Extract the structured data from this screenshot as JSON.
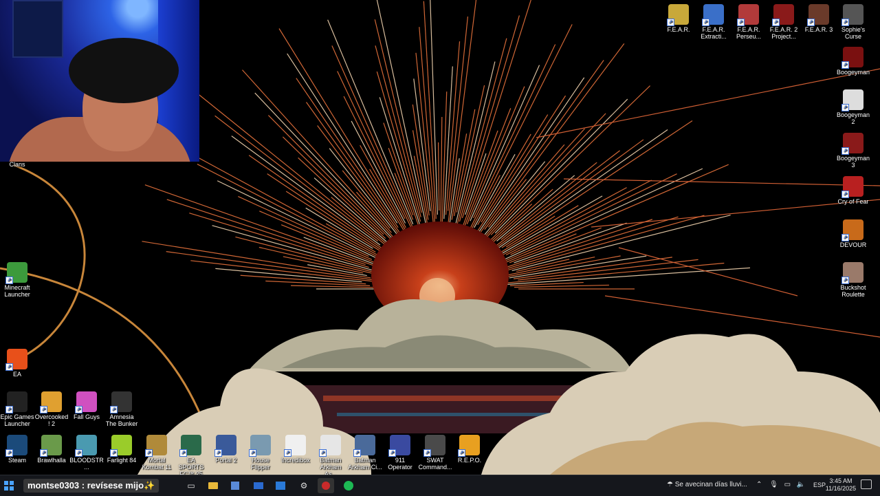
{
  "colors": {
    "taskbar": "#15171c",
    "sun_red": "#9a1a10",
    "ray_orange": "#e8733c",
    "cloud": "#d9cdb6"
  },
  "webcam": {
    "caption": "Clans"
  },
  "desktop_icons": [
    {
      "name": "fear",
      "label": "F.E.A.R.",
      "color": "#c8a83a"
    },
    {
      "name": "fear-extraction",
      "label": "F.E.A.R. Extracti...",
      "color": "#3a6fc8"
    },
    {
      "name": "fear-perseus",
      "label": "F.E.A.R. Perseu...",
      "color": "#b23a3a"
    },
    {
      "name": "fear-2",
      "label": "F.E.A.R. 2 Project...",
      "color": "#8a1a1a"
    },
    {
      "name": "fear-3",
      "label": "F.E.A.R. 3",
      "color": "#6a3a2a"
    },
    {
      "name": "sophies-curse",
      "label": "Sophie's Curse",
      "color": "#555555"
    },
    {
      "name": "boogeyman",
      "label": "Boogeyman",
      "color": "#7a1010"
    },
    {
      "name": "boogeyman-2",
      "label": "Boogeyman 2",
      "color": "#dddddd"
    },
    {
      "name": "boogeyman-3",
      "label": "Boogeyman 3",
      "color": "#8a1a1a"
    },
    {
      "name": "cry-of-fear",
      "label": "Cry of Fear",
      "color": "#b82020"
    },
    {
      "name": "devour",
      "label": "DEVOUR",
      "color": "#c86a1a"
    },
    {
      "name": "buckshot-roulette",
      "label": "Buckshot Roulette",
      "color": "#9a7a6a"
    },
    {
      "name": "minecraft-launcher",
      "label": "Minecraft Launcher",
      "color": "#3c9a3c"
    },
    {
      "name": "ea",
      "label": "EA",
      "color": "#e8501a"
    },
    {
      "name": "epic-games",
      "label": "Epic Games Launcher",
      "color": "#222222"
    },
    {
      "name": "overcooked-2",
      "label": "Overcooked! 2",
      "color": "#e0a030"
    },
    {
      "name": "fall-guys",
      "label": "Fall Guys",
      "color": "#d050c0"
    },
    {
      "name": "amnesia-bunker",
      "label": "Amnesia The Bunker",
      "color": "#333333"
    },
    {
      "name": "steam",
      "label": "Steam",
      "color": "#1b4a7a"
    },
    {
      "name": "brawlhalla",
      "label": "Brawlhalla",
      "color": "#6a9a4a"
    },
    {
      "name": "bloodstrike",
      "label": "BLOODSTR...",
      "color": "#4a9ab0"
    },
    {
      "name": "farlight-84",
      "label": "Farlight 84",
      "color": "#9acc2a"
    },
    {
      "name": "mortal-kombat-11",
      "label": "Mortal Kombat 11",
      "color": "#b08a3a"
    },
    {
      "name": "ea-sports-fc",
      "label": "EA SPORTS FC™ 25",
      "color": "#2a6a4a"
    },
    {
      "name": "portal-2",
      "label": "Portal 2",
      "color": "#3a5a9a"
    },
    {
      "name": "house-flipper",
      "label": "House Flipper",
      "color": "#7a9ab0"
    },
    {
      "name": "incredibox",
      "label": "Incredibox",
      "color": "#f0f0f0"
    },
    {
      "name": "batman-asylum",
      "label": "Batman Arkham As...",
      "color": "#e6e6e6"
    },
    {
      "name": "batman-city",
      "label": "Batman Arkham Ci...",
      "color": "#4a6a9a"
    },
    {
      "name": "911-operator",
      "label": "911 Operator",
      "color": "#3a4aa0"
    },
    {
      "name": "swat-commander",
      "label": "SWAT Command...",
      "color": "#4a4a4a"
    },
    {
      "name": "repo",
      "label": "R.E.P.O.",
      "color": "#e8a020"
    }
  ],
  "taskbar": {
    "chat_overlay": "montse0303 : revísese mijo✨",
    "weather": "Se avecinan días lluvi...",
    "language": "ESP",
    "time": "3:45 AM",
    "date": "11/16/2025"
  }
}
